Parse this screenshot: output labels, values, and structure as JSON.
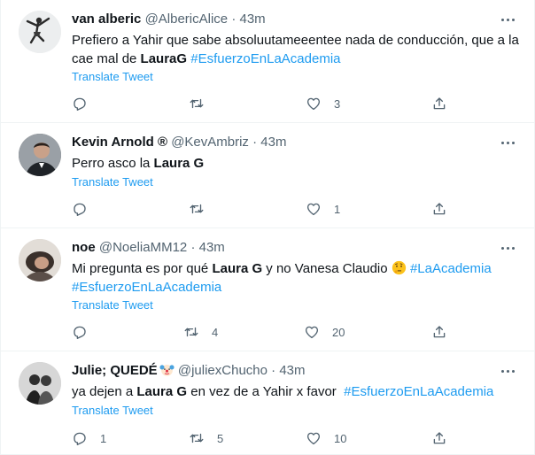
{
  "colors": {
    "link": "#1d9bf0",
    "secondary": "#536471",
    "text": "#0f1419",
    "border": "#eff3f4"
  },
  "tweets": [
    {
      "name": "van alberic",
      "handle": "@AlbericAlice",
      "time": "43m",
      "text_a": "Prefiero a Yahir que sabe absoluutameeentee nada de conducción, que a la cae mal de ",
      "bold1": "LauraG",
      "text_b": " ",
      "tag1": "#EsfuerzoEnLaAcademia",
      "translate": "Translate Tweet",
      "reply": "",
      "retweet": "",
      "like": "3"
    },
    {
      "name": "Kevin Arnold ®",
      "handle": "@KevAmbriz",
      "time": "43m",
      "text_a": "Perro asco la ",
      "bold1": "Laura G",
      "translate": "Translate Tweet",
      "reply": "",
      "retweet": "",
      "like": "1"
    },
    {
      "name": "noe",
      "handle": "@NoeliaMM12",
      "time": "43m",
      "text_a": "Mi pregunta es por qué ",
      "bold1": "Laura G",
      "text_b": " y no Vanesa Claudio ",
      "emoji": "thinking-face-emoji",
      "tag1": "#LaAcademia",
      "tag2": "#EsfuerzoEnLaAcademia",
      "translate": "Translate Tweet",
      "reply": "",
      "retweet": "4",
      "like": "20"
    },
    {
      "name": "Julie; QUEDÉ",
      "name_emoji": "clown-face-emoji",
      "handle": "@juliexChucho",
      "time": "43m",
      "text_a": "ya dejen a ",
      "bold1": "Laura G",
      "text_b": " en vez de a Yahir x favor  ",
      "tag1": "#EsfuerzoEnLaAcademia",
      "translate": "Translate Tweet",
      "reply": "1",
      "retweet": "5",
      "like": "10"
    }
  ]
}
